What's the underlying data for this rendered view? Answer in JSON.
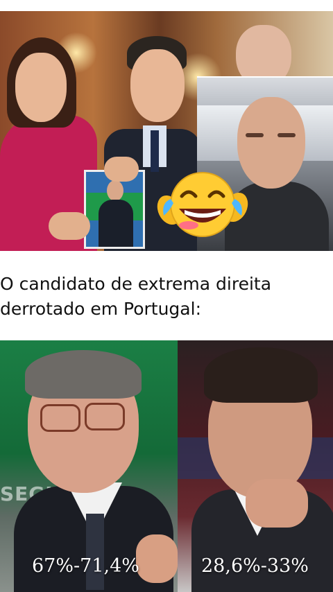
{
  "caption": {
    "line1": "O candidato de extrema direita",
    "line2": "derrotado em Portugal:"
  },
  "results": {
    "left_percentage": "67%-71,4%",
    "right_percentage": "28,6%-33%",
    "background_sign_text": "SEGUR"
  },
  "images": {
    "top_collage": "photo-collage",
    "inset_video": "selfie-video-inset",
    "emoji": "laughing-crying-emoji",
    "left_photo": "winning-candidate-photo",
    "right_photo": "defeated-candidate-photo"
  },
  "colors": {
    "caption_text": "#111111",
    "left_bg_green": "#1b7f45",
    "right_bg_red": "#6a2a30",
    "emoji_yellow": "#ffcc33"
  }
}
